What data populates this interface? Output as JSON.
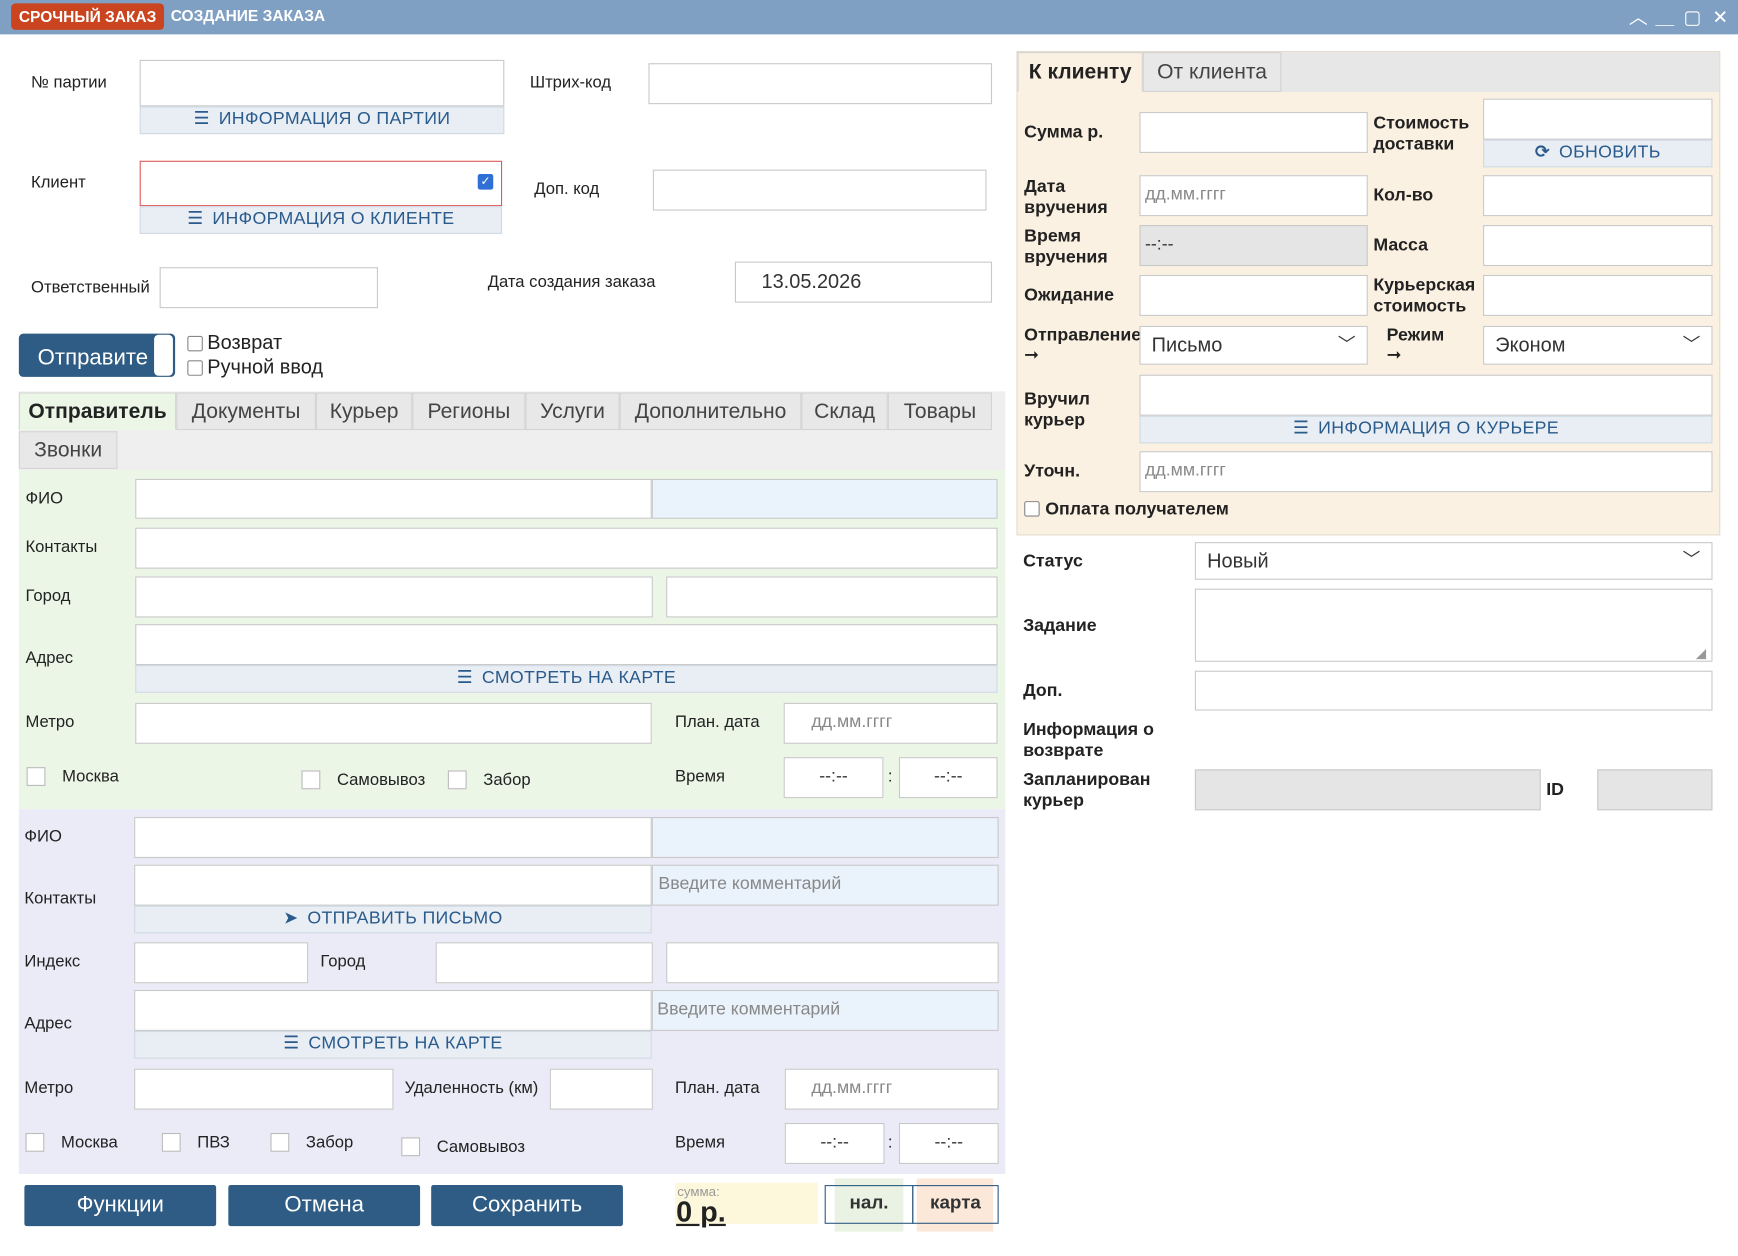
{
  "window": {
    "badge": "СРОЧНЫЙ ЗАКАЗ",
    "title": "СОЗДАНИЕ ЗАКАЗА"
  },
  "header": {
    "batch_label": "№ партии",
    "batch_info": "ИНФОРМАЦИЯ О ПАРТИИ",
    "barcode_label": "Штрих-код",
    "client_label": "Клиент",
    "client_info": "ИНФОРМАЦИЯ О КЛИЕНТЕ",
    "extra_code_label": "Доп. код",
    "responsible_label": "Ответственный",
    "created_label": "Дата создания заказа",
    "created_value": "13.05.2026",
    "send_button": "Отправите",
    "return_label": "Возврат",
    "manual_label": "Ручной ввод"
  },
  "tabs": [
    "Отправитель",
    "Документы",
    "Курьер",
    "Регионы",
    "Услуги",
    "Дополнительно",
    "Склад",
    "Товары",
    "Звонки"
  ],
  "sender": {
    "fio": "ФИО",
    "contacts": "Контакты",
    "city": "Город",
    "address": "Адрес",
    "map": "СМОТРЕТЬ НА КАРТЕ",
    "metro": "Метро",
    "plan_date": "План. дата",
    "plan_date_ph": "дд.мм.гггг",
    "moscow": "Москва",
    "pickup": "Самовывоз",
    "collect": "Забор",
    "time": "Время",
    "time_ph": "--:--"
  },
  "recipient": {
    "fio": "ФИО",
    "contacts": "Контакты",
    "comment_ph": "Введите комментарий",
    "send_letter": "ОТПРАВИТЬ ПИСЬМО",
    "index": "Индекс",
    "city": "Город",
    "address": "Адрес",
    "address_comment_ph": "Введите  комментарий",
    "map": "СМОТРЕТЬ НА КАРТЕ",
    "metro": "Метро",
    "distance": "Удаленность (км)",
    "plan_date": "План. дата",
    "plan_date_ph": "дд.мм.гггг",
    "moscow": "Москва",
    "pvz": "ПВЗ",
    "collect": "Забор",
    "pickup": "Самовывоз",
    "time": "Время",
    "time_ph": "--:--"
  },
  "footer": {
    "functions": "Функции",
    "cancel": "Отмена",
    "save": "Сохранить",
    "sum_caption": "сумма:",
    "sum_value": "0 р.",
    "cash": "нал.",
    "card": "карта"
  },
  "delivery": {
    "tab_to": "К клиенту",
    "tab_from": "От клиента",
    "sum": "Сумма р.",
    "delivery_cost": "Стоимость доставки",
    "refresh": "ОБНОВИТЬ",
    "hand_date": "Дата вручения",
    "date_ph": "дд.мм.гггг",
    "qty": "Кол-во",
    "hand_time": "Время вручения",
    "time_ph": "--:--",
    "mass": "Масса",
    "waiting": "Ожидание",
    "courier_cost": "Курьерская стоимость",
    "dispatch": "Отправление",
    "dispatch_value": "Письмо",
    "mode": "Режим",
    "mode_value": "Эконом",
    "handed_courier": "Вручил курьер",
    "courier_info": "ИНФОРМАЦИЯ О КУРЬЕРЕ",
    "clarify": "Уточн.",
    "paid_by_recipient": "Оплата получателем"
  },
  "status": {
    "status_label": "Статус",
    "status_value": "Новый",
    "task_label": "Задание",
    "extra_label": "Доп.",
    "return_info": "Информация о возврате",
    "planned_courier": "Запланирован курьер",
    "id_label": "ID"
  }
}
